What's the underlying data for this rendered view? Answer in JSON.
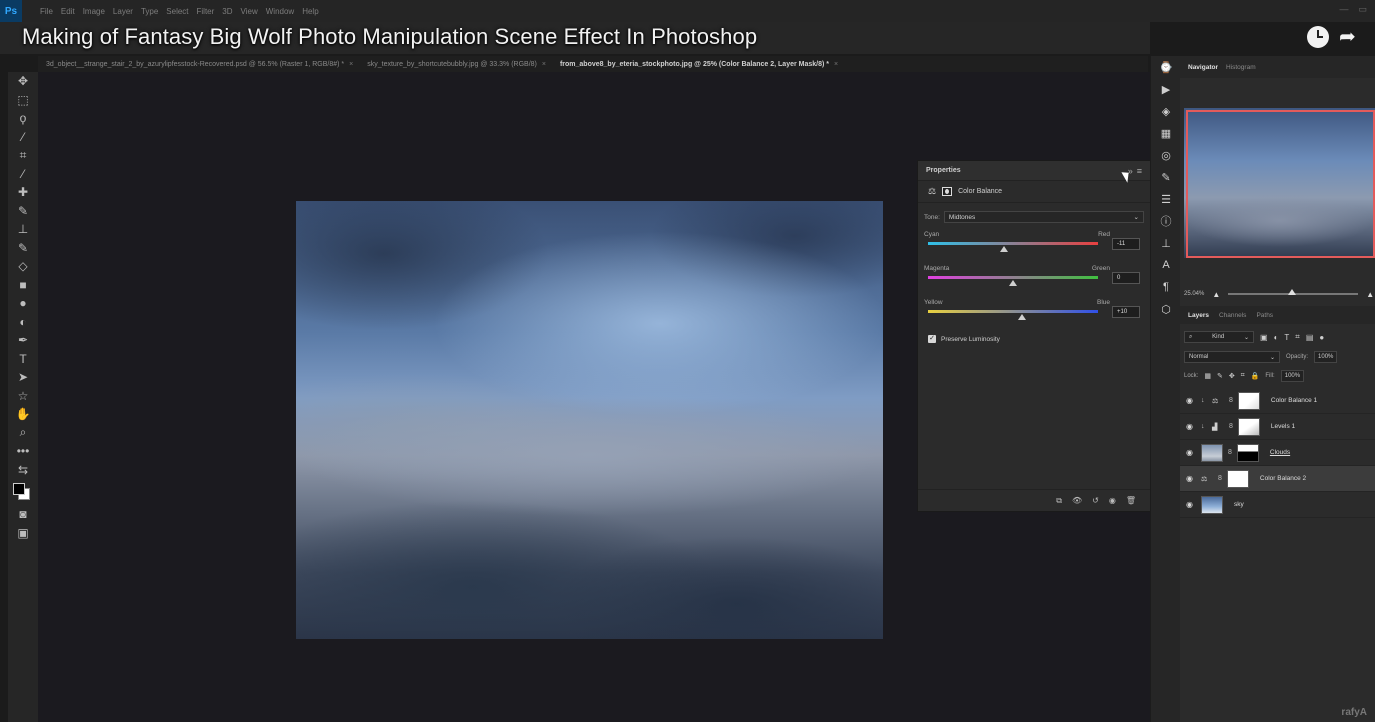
{
  "video_title": "Making of Fantasy Big Wolf Photo Manipulation Scene Effect In Photoshop",
  "menu": [
    "File",
    "Edit",
    "Image",
    "Layer",
    "Type",
    "Select",
    "Filter",
    "3D",
    "View",
    "Window",
    "Help"
  ],
  "app_logo": "Ps",
  "doc_tabs": [
    {
      "label": "3d_object__strange_stair_2_by_azurylipfesstock-Recovered.psd @ 56.5% (Raster 1, RGB/8#) *",
      "close": "×"
    },
    {
      "label": "sky_texture_by_shortcutebubbly.jpg @ 33.3% (RGB/8)",
      "close": "×"
    },
    {
      "label": "from_above8_by_eteria_stockphoto.jpg @ 25% (Color Balance 2, Layer Mask/8) *",
      "close": "×"
    }
  ],
  "properties": {
    "title": "Properties",
    "collapse": "»",
    "adjustment_label": "Color Balance",
    "tone_label": "Tone:",
    "tone_value": "Midtones",
    "sliders": [
      {
        "left": "Cyan",
        "right": "Red",
        "value": "-11",
        "level": -11,
        "track_colors": [
          "#2fc0e8",
          "#e84040"
        ]
      },
      {
        "left": "Magenta",
        "right": "Green",
        "value": "0",
        "level": 0,
        "track_colors": [
          "#e040e0",
          "#40c040"
        ]
      },
      {
        "left": "Yellow",
        "right": "Blue",
        "value": "+10",
        "level": 10,
        "track_colors": [
          "#e8d040",
          "#3050e8"
        ]
      }
    ],
    "preserve_label": "Preserve Luminosity",
    "preserve_checked": true
  },
  "panels": {
    "nav_tabs": [
      "Navigator",
      "Histogram"
    ],
    "zoom": "25.04%",
    "layer_tabs": [
      "Layers",
      "Channels",
      "Paths"
    ],
    "kind": "Kind",
    "blend_mode": "Normal",
    "opacity_label": "Opacity:",
    "opacity": "100%",
    "lock_label": "Lock:",
    "fill_label": "Fill:",
    "fill": "100%",
    "layers": [
      {
        "name": "Color Balance 1",
        "type": "adjustment",
        "icon": "color-balance-icon",
        "clipped": true,
        "selected": false
      },
      {
        "name": "Levels 1",
        "type": "adjustment",
        "icon": "levels-icon",
        "clipped": true,
        "selected": false
      },
      {
        "name": "Clouds",
        "type": "image",
        "clipped": false,
        "selected": false
      },
      {
        "name": "Color Balance 2",
        "type": "adjustment",
        "icon": "color-balance-icon",
        "clipped": false,
        "selected": true
      },
      {
        "name": "sky",
        "type": "image",
        "clipped": false,
        "selected": false
      }
    ]
  },
  "watermark": "rafyA"
}
